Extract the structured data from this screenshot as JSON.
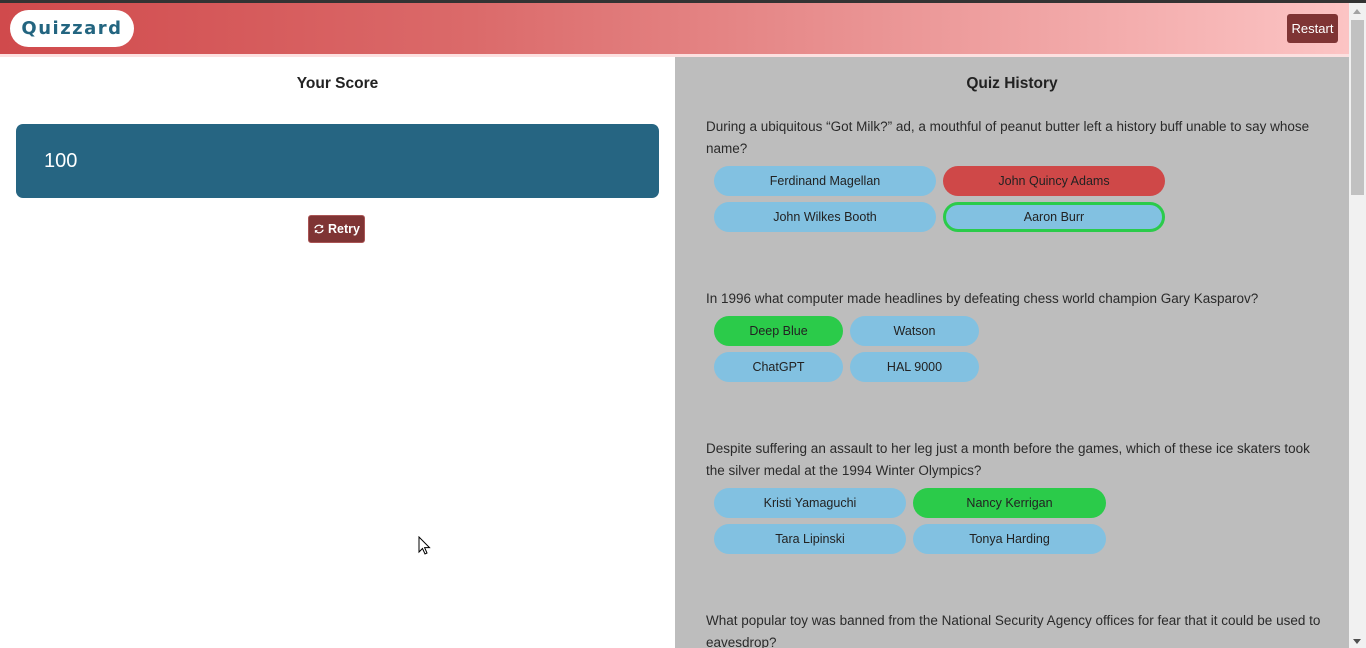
{
  "navbar": {
    "brand": "Quizzard",
    "restart_label": "Restart"
  },
  "score_panel": {
    "title": "Your Score",
    "score": "100",
    "retry_label": "Retry",
    "retry_icon": "refresh-icon"
  },
  "history_panel": {
    "title": "Quiz History",
    "questions": [
      {
        "text": "During a ubiquitous “Got Milk?” ad, a mouthful of peanut butter left a history buff unable to say whose name?",
        "answers": [
          {
            "label": "Ferdinand Magellan",
            "state": "neutral"
          },
          {
            "label": "John Quincy Adams",
            "state": "wrong-selected"
          },
          {
            "label": "John Wilkes Booth",
            "state": "neutral"
          },
          {
            "label": "Aaron Burr",
            "state": "correct-unselected"
          }
        ]
      },
      {
        "text": "In 1996 what computer made headlines by defeating chess world champion Gary Kasparov?",
        "answers": [
          {
            "label": "Deep Blue",
            "state": "correct-selected"
          },
          {
            "label": "Watson",
            "state": "neutral"
          },
          {
            "label": "ChatGPT",
            "state": "neutral"
          },
          {
            "label": "HAL 9000",
            "state": "neutral"
          }
        ]
      },
      {
        "text": "Despite suffering an assault to her leg just a month before the games, which of these ice skaters took the silver medal at the 1994 Winter Olympics?",
        "answers": [
          {
            "label": "Kristi Yamaguchi",
            "state": "neutral"
          },
          {
            "label": "Nancy Kerrigan",
            "state": "correct-selected"
          },
          {
            "label": "Tara Lipinski",
            "state": "neutral"
          },
          {
            "label": "Tonya Harding",
            "state": "neutral"
          }
        ]
      },
      {
        "text": "What popular toy was banned from the National Security Agency offices for fear that it could be used to eavesdrop?",
        "answers": []
      }
    ]
  },
  "colors": {
    "brand_text": "#236580",
    "score_box": "#266582",
    "button_dark_red": "#7f3434",
    "answer_neutral": "#82c1e1",
    "answer_correct": "#2bcb4a",
    "answer_wrong": "#cf4848",
    "history_bg": "#bdbdbd"
  }
}
